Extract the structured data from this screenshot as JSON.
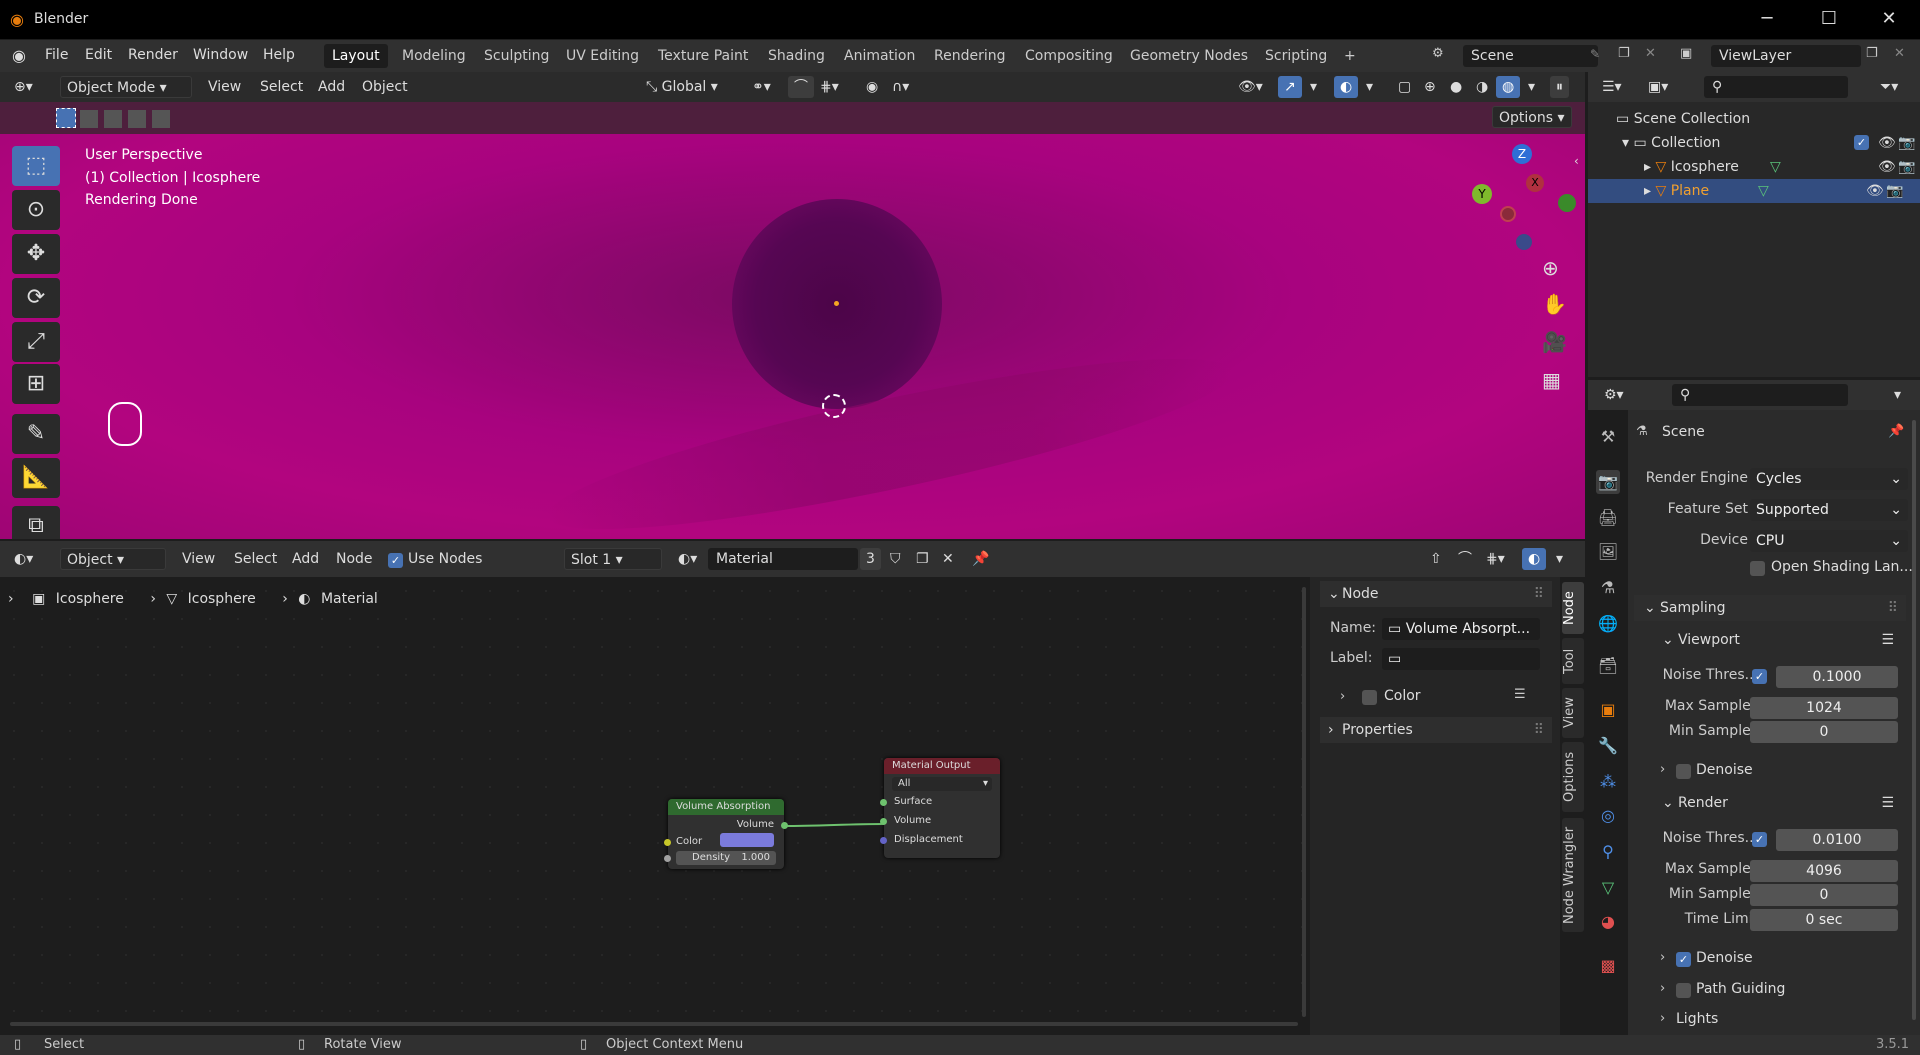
{
  "window": {
    "title": "Blender",
    "minimize": "─",
    "maximize": "☐",
    "close": "✕"
  },
  "menu": [
    "File",
    "Edit",
    "Render",
    "Window",
    "Help"
  ],
  "workspaces": [
    "Layout",
    "Modeling",
    "Sculpting",
    "UV Editing",
    "Texture Paint",
    "Shading",
    "Animation",
    "Rendering",
    "Compositing",
    "Geometry Nodes",
    "Scripting"
  ],
  "active_workspace": "Layout",
  "add_tab": "+",
  "scene": {
    "name": "Scene",
    "view_layer": "ViewLayer"
  },
  "viewport_header": {
    "mode": "Object Mode",
    "menus": [
      "View",
      "Select",
      "Add",
      "Object"
    ],
    "orientation": "Global",
    "options": "Options"
  },
  "viewport_overlay": {
    "line1": "User Perspective",
    "line2": "(1) Collection | Icosphere",
    "line3": "Rendering Done"
  },
  "gizmo": {
    "z": "Z",
    "x": "X",
    "y": "Y"
  },
  "node_header": {
    "editor_type": "Object",
    "menus": [
      "View",
      "Select",
      "Add",
      "Node"
    ],
    "use_nodes": "Use Nodes",
    "slot": "Slot 1",
    "material": "Material",
    "users": "3"
  },
  "breadcrumb": [
    "Icosphere",
    "Icosphere",
    "Material"
  ],
  "nodes": {
    "absorption": {
      "title": "Volume Absorption",
      "out": "Volume",
      "color_label": "Color",
      "density_label": "Density",
      "density": "1.000",
      "swatch": "#7b7bdc"
    },
    "output": {
      "title": "Material Output",
      "target": "All",
      "inputs": [
        "Surface",
        "Volume",
        "Displacement"
      ]
    }
  },
  "npanel": {
    "section": "Node",
    "name_label": "Name:",
    "name_value": "Volume Absorpt...",
    "label_label": "Label:",
    "color": "Color",
    "properties": "Properties"
  },
  "npanel_tabs": [
    "Node",
    "Tool",
    "View",
    "Options",
    "Node Wrangler"
  ],
  "outliner": {
    "root": "Scene Collection",
    "collection": "Collection",
    "objects": [
      "Icosphere",
      "Plane"
    ]
  },
  "properties": {
    "context": "Scene",
    "render_engine_label": "Render Engine",
    "render_engine": "Cycles",
    "feature_set_label": "Feature Set",
    "feature_set": "Supported",
    "device_label": "Device",
    "device": "CPU",
    "osl": "Open Shading Lan...",
    "sampling": "Sampling",
    "viewport": "Viewport",
    "noise_label": "Noise Thres...",
    "vp_noise": "0.1000",
    "max_samples_label": "Max Samples",
    "vp_max": "1024",
    "min_samples_label": "Min Samples",
    "vp_min": "0",
    "denoise": "Denoise",
    "render": "Render",
    "r_noise": "0.0100",
    "r_max": "4096",
    "r_min": "0",
    "time_limit_label": "Time Limit",
    "time_limit": "0 sec",
    "path_guiding": "Path Guiding",
    "lights": "Lights"
  },
  "statusbar": {
    "select": "Select",
    "rotate": "Rotate View",
    "context": "Object Context Menu",
    "version": "3.5.1"
  }
}
